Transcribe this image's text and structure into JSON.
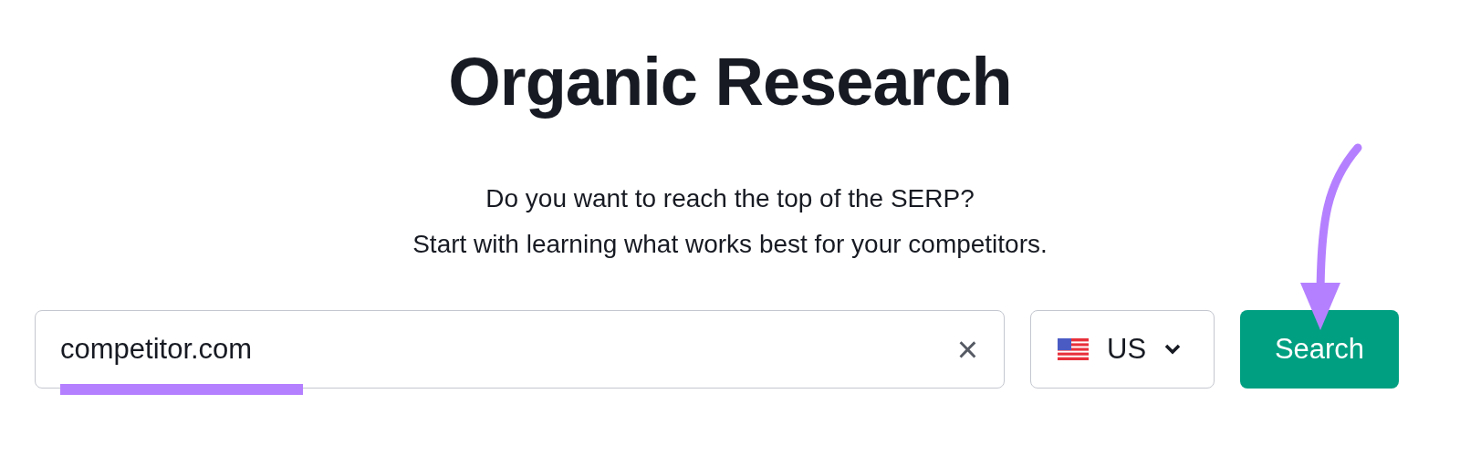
{
  "title": "Organic Research",
  "subtitle": [
    "Do you want to reach the top of the SERP?",
    "Start with learning what works best for your competitors."
  ],
  "search_field": {
    "value": "competitor.com"
  },
  "clear_button": {
    "text": "×"
  },
  "country_select": {
    "value": "US"
  },
  "search_button": {
    "label": "Search"
  }
}
